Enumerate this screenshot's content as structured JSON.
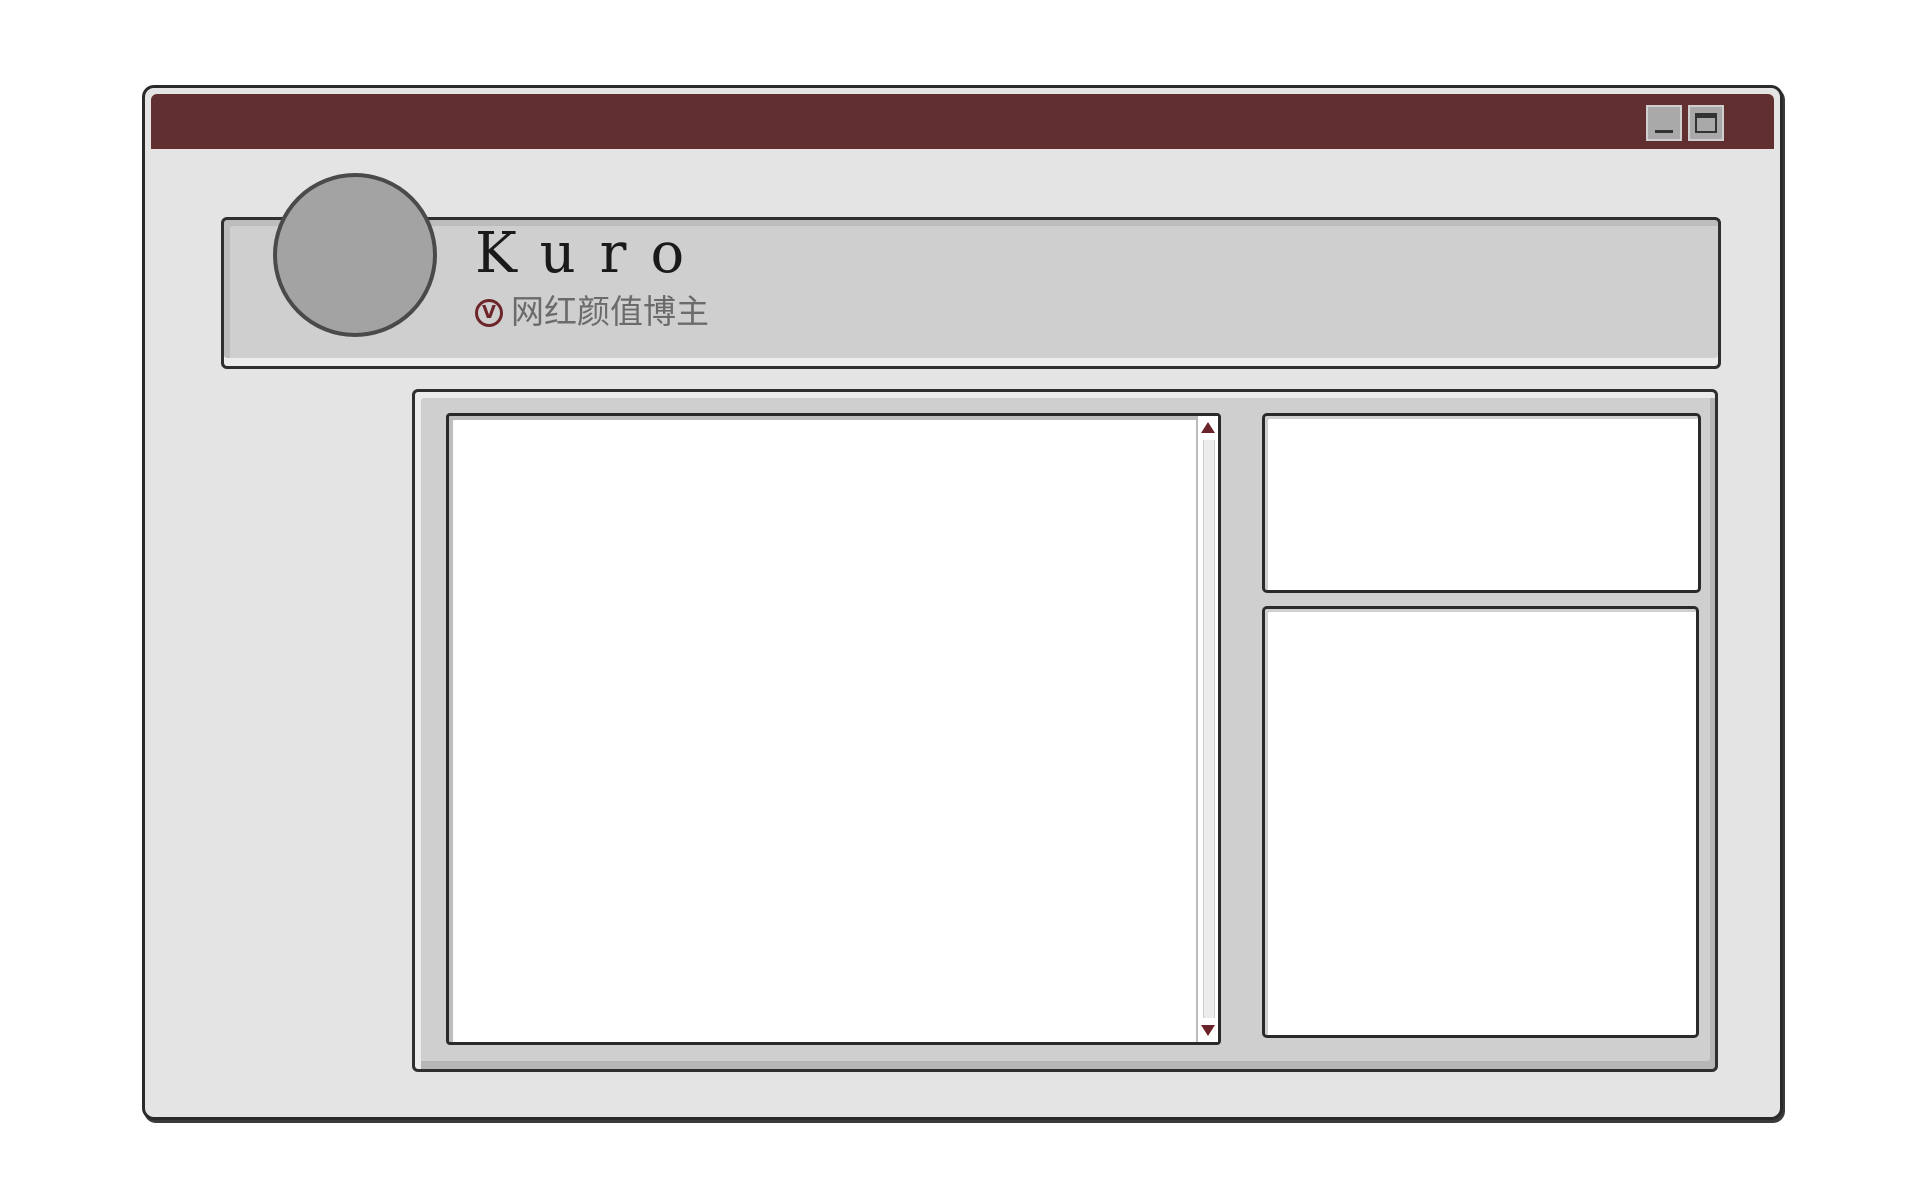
{
  "window": {
    "titlebar_color": "#622f31",
    "controls": {
      "minimize_icon": "minimize-icon",
      "maximize_icon": "maximize-icon"
    }
  },
  "profile": {
    "name": "Kuro",
    "verified_icon": "verified-v-icon",
    "verified_glyph": "V",
    "subtitle": "网红颜值博主",
    "accent_color": "#6d2529"
  },
  "panels": {
    "scroll_up_icon": "triangle-up-icon",
    "scroll_down_icon": "triangle-down-icon"
  }
}
